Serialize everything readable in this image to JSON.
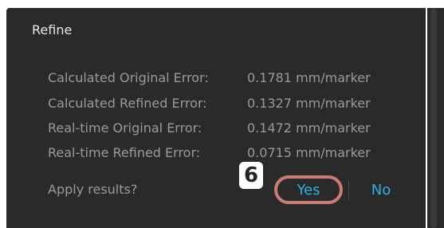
{
  "panel": {
    "title": "Refine",
    "stats": [
      {
        "label": "Calculated Original Error:",
        "value": "0.1781 mm/marker"
      },
      {
        "label": "Calculated Refined Error:",
        "value": "0.1327 mm/marker"
      },
      {
        "label": "Real-time Original Error:",
        "value": "0.1472 mm/marker"
      },
      {
        "label": "Real-time Refined Error:",
        "value": "0.0715 mm/marker"
      }
    ],
    "apply_prompt": "Apply results?",
    "step_marker": "6",
    "yes_label": "Yes",
    "no_label": "No"
  },
  "colors": {
    "panel_bg": "#2a2a2a",
    "text_muted": "#9a9a9a",
    "title_text": "#e8e8e8",
    "accent": "#2fb0e0",
    "highlight_ring": "#c97e72"
  }
}
